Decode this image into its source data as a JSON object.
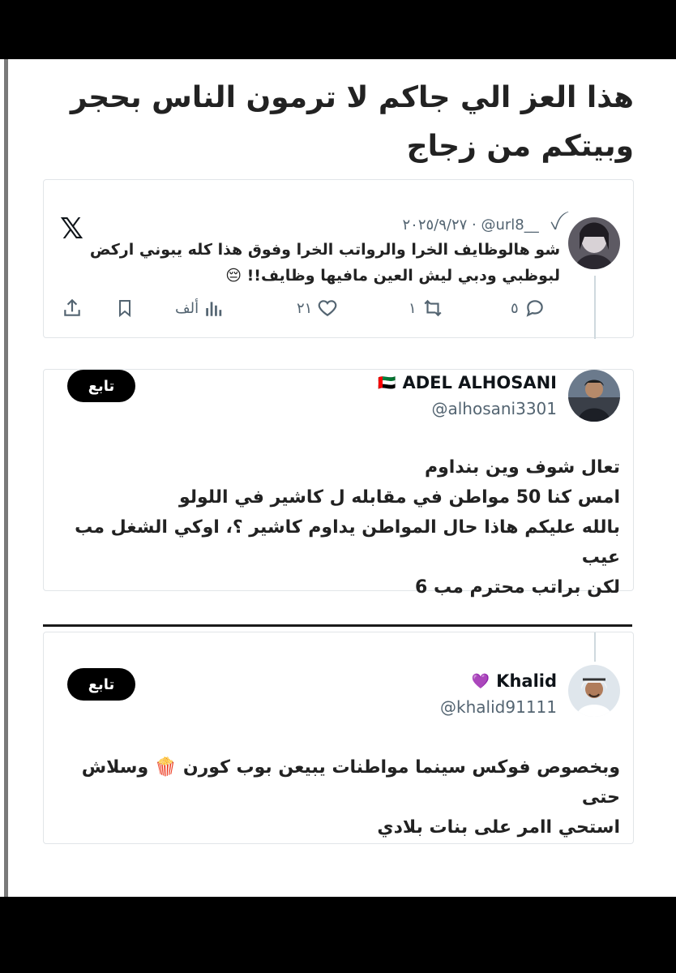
{
  "post": {
    "title": "هذا العز الي جاكم لا ترمون الناس بحجر وبيتكم من زجاج"
  },
  "tweet1": {
    "handle": "@url8__",
    "date": "٢٠٢٥/٩/٢٧",
    "dot": "·",
    "text": "شو هالوظايف الخرا والرواتب الخرا وفوق هذا كله يبوني اركض لبوظبي ودبي ليش العين مافيها وظايف!! 😔",
    "replies": "٥",
    "reposts": "١",
    "likes": "٢١",
    "views": "ألف",
    "brand_icon": "x-logo-icon"
  },
  "tweet2": {
    "name": "ADEL ALHOSANI",
    "flag": "🇦🇪",
    "handle": "@alhosani3301",
    "follow_label": "تابع",
    "lines": [
      "تعال شوف وين بنداوم",
      "امس كنا 50 مواطن في مقابله ل كاشير في اللولو",
      "بالله عليكم هاذا حال المواطن يداوم كاشير ؟، اوكي الشغل مب عيب",
      "لكن براتب محترم مب 6"
    ]
  },
  "tweet3": {
    "name": "Khalid",
    "heart": "💜",
    "handle": "@khalid91111",
    "follow_label": "تابع",
    "lines": [
      "وبخصوص فوكس سينما مواطنات يبيعن بوب كورن 🍿 وسلاش حتى",
      "استحي اامر على بنات بلادي"
    ]
  },
  "colors": {
    "muted": "#536471",
    "accent": "#000000",
    "divider": "#e1e5e8"
  }
}
